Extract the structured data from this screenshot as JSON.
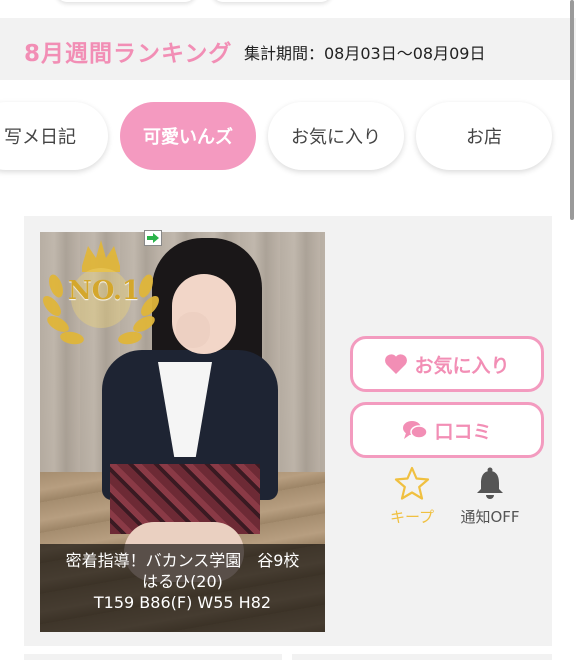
{
  "ranking": {
    "title": "8月週間ランキング",
    "period": "集計期間：08月03日〜08月09日"
  },
  "tabs": [
    {
      "label": "写メ日記",
      "active": false
    },
    {
      "label": "可愛いんズ",
      "active": true
    },
    {
      "label": "お気に入り",
      "active": false
    },
    {
      "label": "お店",
      "active": false
    }
  ],
  "profile": {
    "rank_badge": "NO.1",
    "shop_line": "密着指導！バカンス学園　谷9校",
    "name_age": "はるひ(20)",
    "measurements": "T159 B86(F) W55 H82"
  },
  "actions": {
    "favorite_label": "お気に入り",
    "review_label": "口コミ",
    "keep_label": "キープ",
    "notify_label": "通知OFF"
  },
  "colors": {
    "accent_pink": "#f28eb5",
    "button_border": "#f39bbf",
    "keep_yellow": "#f0c040"
  },
  "icons": {
    "favorite": "heart-icon",
    "review": "speech-bubble-icon",
    "keep": "star-outline-icon",
    "notify": "bell-icon"
  }
}
